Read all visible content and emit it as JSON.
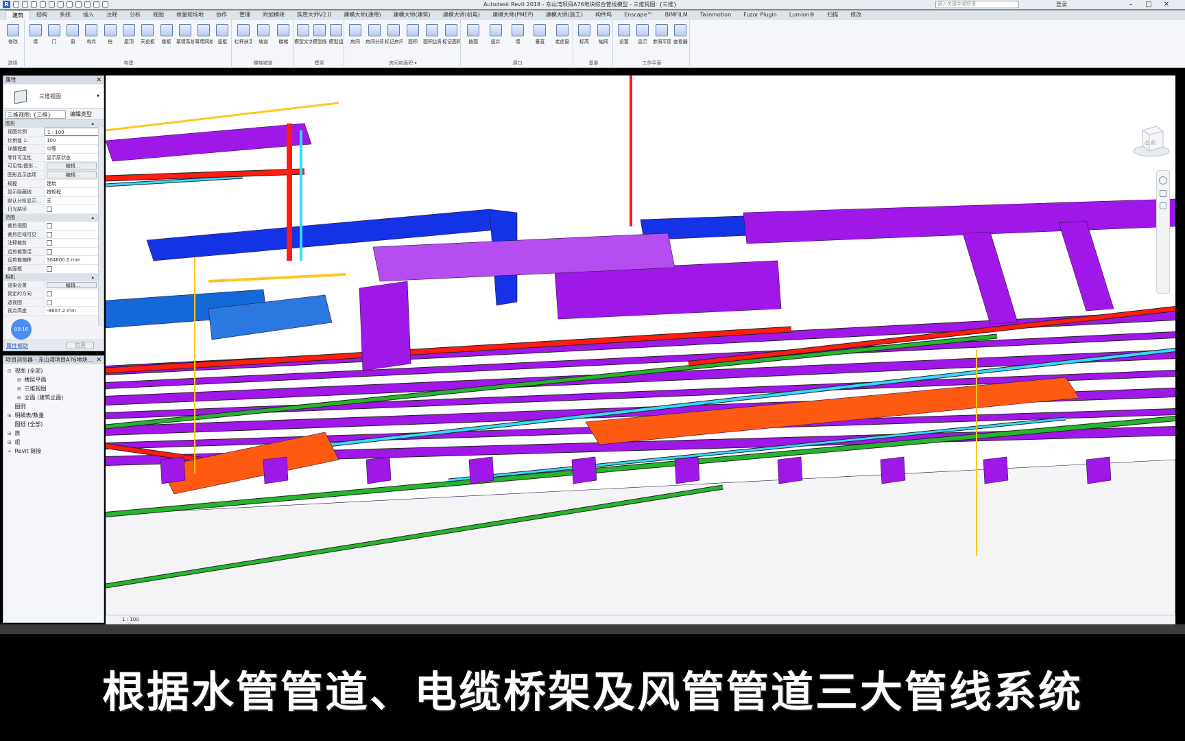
{
  "window": {
    "title": "Autodesk Revit 2018 -   东山湾项目A76地块综合管线模型 - 三维视图: {三维}",
    "search_placeholder": "键入关键字或短语",
    "user": "登录",
    "logo": "R"
  },
  "ribbon": {
    "tabs": [
      "建筑",
      "结构",
      "系统",
      "插入",
      "注释",
      "分析",
      "视图",
      "体量和场地",
      "协作",
      "管理",
      "附加模块",
      "族库大师V2.0",
      "建模大师(通用)",
      "建模大师(建筑)",
      "建模大师(机电)",
      "建模大师(PMEP)",
      "建模大师(施工)",
      "构件坞",
      "Enscape™",
      "BIMFILM",
      "Twinmotion",
      "Fuzor Plugin",
      "Lumion®",
      "扫描",
      "修改"
    ],
    "active_tab": "建筑",
    "groups": [
      {
        "label": "选择",
        "buttons": [
          "修改"
        ]
      },
      {
        "label": "构建",
        "buttons": [
          "墙",
          "门",
          "窗",
          "构件",
          "柱",
          "屋顶",
          "天花板",
          "楼板",
          "幕墙系统",
          "幕墙网格",
          "竖梃"
        ]
      },
      {
        "label": "楼梯坡道",
        "buttons": [
          "栏杆扶手",
          "坡道",
          "楼梯"
        ]
      },
      {
        "label": "模型",
        "buttons": [
          "模型文字",
          "模型线",
          "模型组"
        ]
      },
      {
        "label": "房间和面积 ▾",
        "buttons": [
          "房间",
          "房间分隔",
          "标记房间",
          "面积",
          "面积边界",
          "标记面积"
        ]
      },
      {
        "label": "洞口",
        "buttons": [
          "按面",
          "竖井",
          "墙",
          "垂直",
          "老虎窗"
        ]
      },
      {
        "label": "基准",
        "buttons": [
          "标高",
          "轴网"
        ]
      },
      {
        "label": "工作平面",
        "buttons": [
          "设置",
          "显示",
          "参照平面",
          "查看器"
        ]
      }
    ]
  },
  "properties": {
    "title": "属性",
    "type_name": "三维视图",
    "view_selector": "三维视图: {三维}",
    "edit_type": "编辑类型",
    "groups": [
      {
        "name": "图形",
        "rows": [
          {
            "k": "视图比例",
            "v": "1 : 100",
            "t": "input"
          },
          {
            "k": "比例值 1:",
            "v": "100",
            "t": "text"
          },
          {
            "k": "详细程度",
            "v": "中等",
            "t": "text"
          },
          {
            "k": "零件可见性",
            "v": "显示原状态",
            "t": "text"
          },
          {
            "k": "可见性/图形...",
            "v": "编辑...",
            "t": "btn"
          },
          {
            "k": "图形显示选项",
            "v": "编辑...",
            "t": "btn"
          },
          {
            "k": "规程",
            "v": "建筑",
            "t": "text"
          },
          {
            "k": "显示隐藏线",
            "v": "按规程",
            "t": "text"
          },
          {
            "k": "默认分析显示...",
            "v": "无",
            "t": "text"
          },
          {
            "k": "日光路径",
            "v": "",
            "t": "check"
          }
        ]
      },
      {
        "name": "范围",
        "rows": [
          {
            "k": "裁剪视图",
            "v": "",
            "t": "check"
          },
          {
            "k": "裁剪区域可见",
            "v": "",
            "t": "check"
          },
          {
            "k": "注释裁剪",
            "v": "",
            "t": "check"
          },
          {
            "k": "远剪裁激活",
            "v": "",
            "t": "check"
          },
          {
            "k": "远剪裁偏移",
            "v": "304800.0 mm",
            "t": "text"
          },
          {
            "k": "剖面框",
            "v": "",
            "t": "check"
          }
        ]
      },
      {
        "name": "相机",
        "rows": [
          {
            "k": "渲染设置",
            "v": "编辑...",
            "t": "btn"
          },
          {
            "k": "锁定的方向",
            "v": "",
            "t": "check"
          },
          {
            "k": "透视图",
            "v": "",
            "t": "check"
          },
          {
            "k": "视点高度",
            "v": "-8607.2 mm",
            "t": "text"
          }
        ]
      }
    ],
    "help": "属性帮助",
    "apply": "应用",
    "timer": "00:16"
  },
  "browser": {
    "title": "项目浏览器 - 东山湾项目A76地块...",
    "nodes": [
      {
        "level": 0,
        "toggle": "⊟",
        "label": "视图 (全部)"
      },
      {
        "level": 1,
        "toggle": "⊞",
        "label": "楼层平面"
      },
      {
        "level": 1,
        "toggle": "⊞",
        "label": "三维视图"
      },
      {
        "level": 1,
        "toggle": "⊞",
        "label": "立面 (建筑立面)"
      },
      {
        "level": 0,
        "toggle": "",
        "label": "图例"
      },
      {
        "level": 0,
        "toggle": "⊞",
        "label": "明细表/数量"
      },
      {
        "level": 0,
        "toggle": "",
        "label": "图纸 (全部)"
      },
      {
        "level": 0,
        "toggle": "⊞",
        "label": "族"
      },
      {
        "level": 0,
        "toggle": "⊞",
        "label": "组"
      },
      {
        "level": 0,
        "toggle": "∞",
        "label": "Revit 链接"
      }
    ]
  },
  "viewport": {
    "viewcube_label": "左 前",
    "scale": "1 : 100"
  },
  "colors": {
    "duct_purple": "#a018e8",
    "duct_blue": "#1432e6",
    "pipe_red": "#ff1c10",
    "pipe_orange": "#ff5a12",
    "pipe_green": "#25b52c",
    "pipe_cyan": "#35d8ff",
    "pipe_yellow": "#ffc51f",
    "equipment_blue": "#1468d8"
  },
  "caption": {
    "text": "根据水管管道、电缆桥架及风管管道三大管线系统"
  }
}
